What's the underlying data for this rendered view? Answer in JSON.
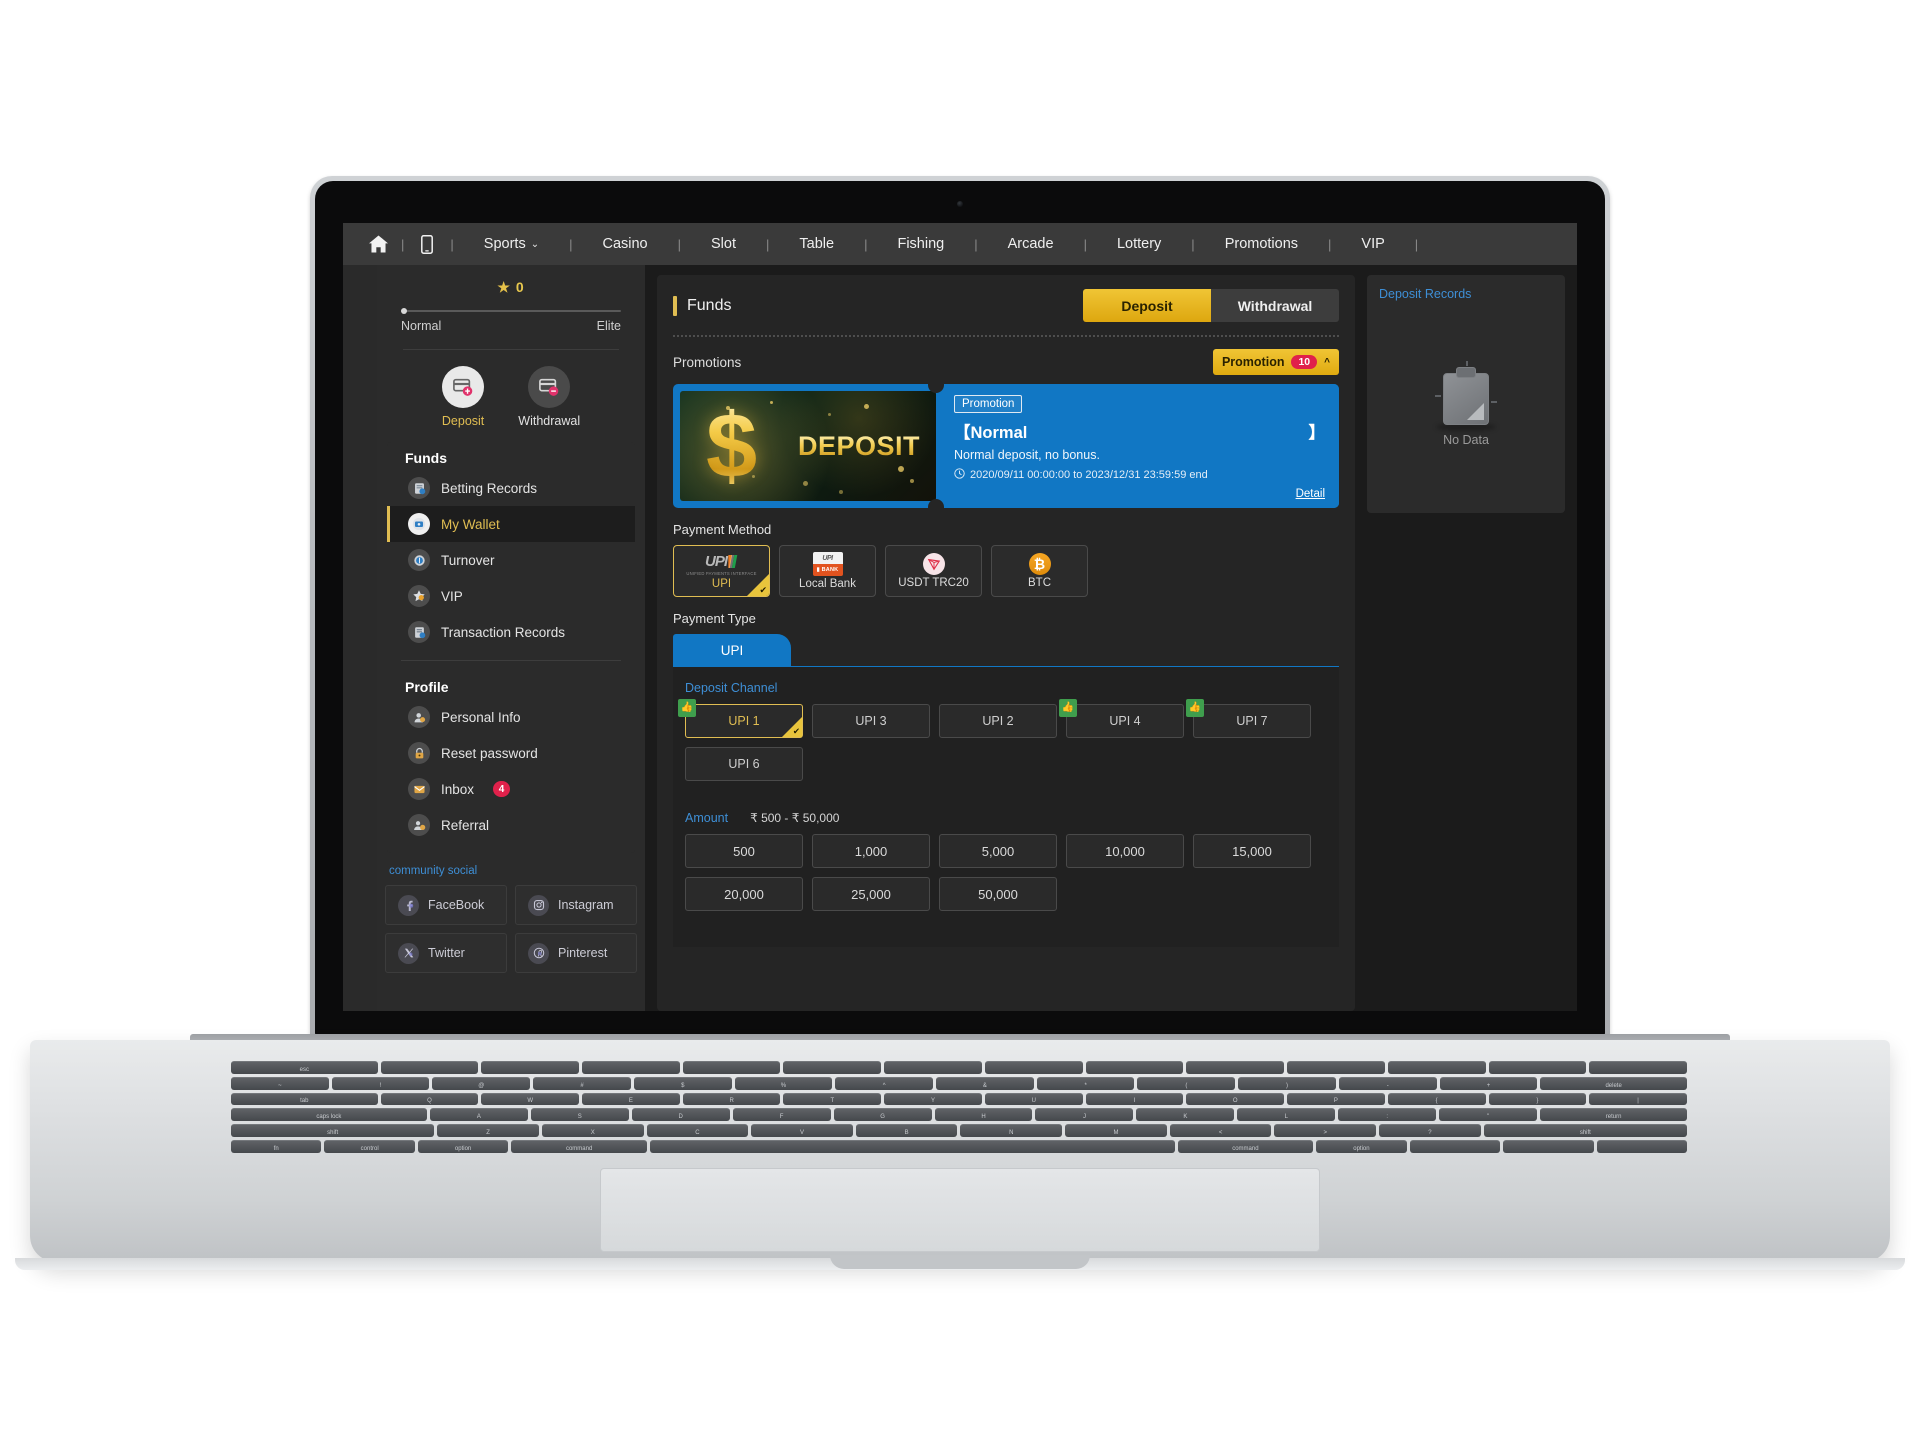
{
  "topnav": {
    "home_icon": "home-icon",
    "mobile_icon": "mobile-icon",
    "items": [
      {
        "label": "Sports",
        "has_caret": true
      },
      {
        "label": "Casino",
        "has_caret": false
      },
      {
        "label": "Slot",
        "has_caret": false
      },
      {
        "label": "Table",
        "has_caret": false
      },
      {
        "label": "Fishing",
        "has_caret": false
      },
      {
        "label": "Arcade",
        "has_caret": false
      },
      {
        "label": "Lottery",
        "has_caret": false
      },
      {
        "label": "Promotions",
        "has_caret": false
      },
      {
        "label": "VIP",
        "has_caret": false
      }
    ],
    "separator": "|",
    "caret": "⌄"
  },
  "sidebar": {
    "vip": {
      "star_glyph": "★",
      "star_count": "0",
      "level_low": "Normal",
      "level_high": "Elite"
    },
    "quick_actions": [
      {
        "label": "Deposit",
        "icon": "deposit-card-icon",
        "style": "gold"
      },
      {
        "label": "Withdrawal",
        "icon": "withdrawal-card-icon",
        "style": "grey"
      }
    ],
    "funds_section_title": "Funds",
    "funds_items": [
      {
        "label": "Betting Records",
        "icon": "betting-records-icon",
        "active": false
      },
      {
        "label": "My Wallet",
        "icon": "wallet-icon",
        "active": true
      },
      {
        "label": "Turnover",
        "icon": "turnover-icon",
        "active": false
      },
      {
        "label": "VIP",
        "icon": "vip-star-icon",
        "active": false
      },
      {
        "label": "Transaction Records",
        "icon": "transaction-records-icon",
        "active": false
      }
    ],
    "profile_section_title": "Profile",
    "profile_items": [
      {
        "label": "Personal Info",
        "icon": "person-icon",
        "badge": ""
      },
      {
        "label": "Reset password",
        "icon": "lock-icon",
        "badge": ""
      },
      {
        "label": "Inbox",
        "icon": "envelope-icon",
        "badge": "4"
      },
      {
        "label": "Referral",
        "icon": "referral-icon",
        "badge": ""
      }
    ],
    "community_label": "community social",
    "social": [
      {
        "label": "FaceBook",
        "icon": "facebook-icon"
      },
      {
        "label": "Instagram",
        "icon": "instagram-icon"
      },
      {
        "label": "Twitter",
        "icon": "twitter-x-icon"
      },
      {
        "label": "Pinterest",
        "icon": "pinterest-icon"
      }
    ]
  },
  "main": {
    "page_title": "Funds",
    "tabs": [
      {
        "label": "Deposit",
        "active": true
      },
      {
        "label": "Withdrawal",
        "active": false
      }
    ],
    "promotions": {
      "section_label": "Promotions",
      "button_label": "Promotion",
      "button_count": "10",
      "button_chevron": "^",
      "card": {
        "banner_text": "DEPOSIT",
        "banner_symbol": "$",
        "tag": "Promotion",
        "name_open": "【Normal",
        "name_close": "】",
        "description": "Normal deposit, no bonus.",
        "clock_icon": "clock-icon",
        "time_range": "2020/09/11 00:00:00 to 2023/12/31 23:59:59 end",
        "detail_link": "Detail"
      }
    },
    "payment_method": {
      "label": "Payment Method",
      "options": [
        {
          "name": "UPI",
          "icon": "upi-logo-icon",
          "sub": "UNIFIED PAYMENTS INTERFACE",
          "selected": true
        },
        {
          "name": "Local Bank",
          "icon": "bank-upi-icon",
          "selected": false
        },
        {
          "name": "USDT TRC20",
          "icon": "tron-icon",
          "selected": false
        },
        {
          "name": "BTC",
          "icon": "bitcoin-icon",
          "selected": false
        }
      ]
    },
    "payment_type": {
      "label": "Payment Type",
      "tabs": [
        {
          "label": "UPI",
          "active": true
        }
      ],
      "deposit_channel_label": "Deposit Channel",
      "channels": [
        {
          "label": "UPI 1",
          "selected": true,
          "recommended": true
        },
        {
          "label": "UPI 3",
          "selected": false,
          "recommended": false
        },
        {
          "label": "UPI 2",
          "selected": false,
          "recommended": false
        },
        {
          "label": "UPI 4",
          "selected": false,
          "recommended": true
        },
        {
          "label": "UPI 7",
          "selected": false,
          "recommended": true
        },
        {
          "label": "UPI 6",
          "selected": false,
          "recommended": false
        }
      ],
      "recommend_icon": "thumbs-up-icon"
    },
    "amount": {
      "label": "Amount",
      "range": "₹ 500 - ₹ 50,000",
      "presets": [
        "500",
        "1,000",
        "5,000",
        "10,000",
        "15,000",
        "20,000",
        "25,000",
        "50,000"
      ]
    }
  },
  "right_panel": {
    "title": "Deposit Records",
    "empty_icon": "clipboard-icon",
    "empty_text": "No Data"
  },
  "keyboard": {
    "row1": [
      "esc",
      "",
      "",
      "",
      "",
      "",
      "",
      "",
      "",
      "",
      "",
      "",
      "",
      ""
    ],
    "row2": [
      "~",
      "!",
      "@",
      "#",
      "$",
      "%",
      "^",
      "&",
      "*",
      "(",
      ")",
      "-",
      "+",
      "delete"
    ],
    "row3": [
      "tab",
      "Q",
      "W",
      "E",
      "R",
      "T",
      "Y",
      "U",
      "I",
      "O",
      "P",
      "{",
      "}",
      "|"
    ],
    "row4": [
      "caps lock",
      "A",
      "S",
      "D",
      "F",
      "G",
      "H",
      "J",
      "K",
      "L",
      ":",
      "\"",
      "return"
    ],
    "row5": [
      "shift",
      "Z",
      "X",
      "C",
      "V",
      "B",
      "N",
      "M",
      "<",
      ">",
      "?",
      "shift"
    ],
    "row6": [
      "fn",
      "control",
      "option",
      "command",
      "",
      "command",
      "option",
      "",
      ""
    ]
  },
  "colors": {
    "accent_gold": "#e0bd52",
    "accent_blue": "#1177c4",
    "badge_red": "#e0214b",
    "bg_dark": "#1b1b1b",
    "panel": "#2b2b2b"
  }
}
